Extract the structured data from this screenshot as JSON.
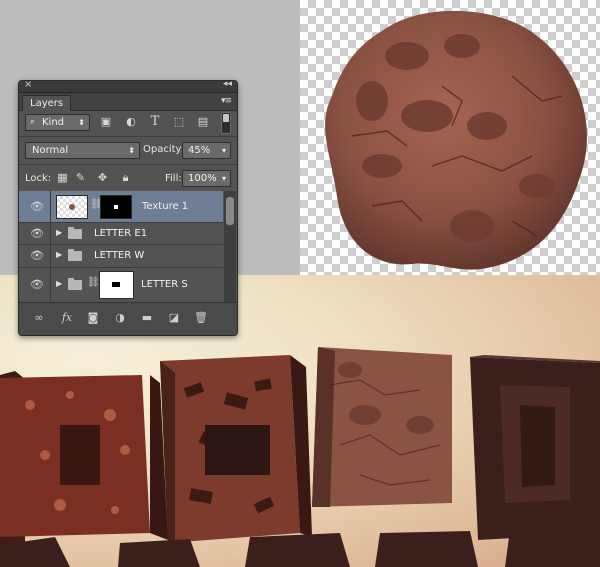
{
  "panel": {
    "close_glyph": "×",
    "collapse_glyph": "◂◂",
    "tab_label": "Layers",
    "menu_glyph": "▾≡",
    "filter": {
      "label": "Kind",
      "icons": [
        "image-filter-icon",
        "adjustment-filter-icon",
        "type-filter-icon",
        "shape-filter-icon",
        "smart-object-filter-icon"
      ]
    },
    "blend_mode": "Normal",
    "opacity_label": "Opacity:",
    "opacity_value": "45%",
    "lock_label": "Lock:",
    "fill_label": "Fill:",
    "fill_value": "100%",
    "layers": [
      {
        "name": "Texture 1",
        "type": "layer-with-mask",
        "selected": true
      },
      {
        "name": "LETTER E1",
        "type": "group"
      },
      {
        "name": "LETTER W",
        "type": "group"
      },
      {
        "name": "LETTER S",
        "type": "group-with-mask"
      }
    ],
    "bottom_icons": [
      "link-layers-icon",
      "fx-icon",
      "add-mask-icon",
      "adjustment-layer-icon",
      "new-group-icon",
      "new-layer-icon",
      "trash-icon"
    ]
  },
  "colors": {
    "panel_bg": "#535353",
    "selected_row": "#6d7e95",
    "chocolate": "#4a2a26",
    "cookie": "#8a5344"
  }
}
